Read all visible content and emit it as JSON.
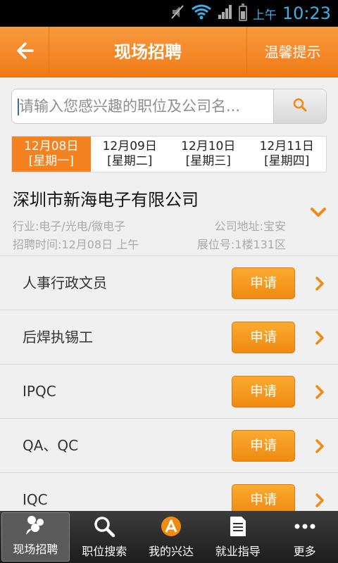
{
  "status": {
    "ampm": "上午",
    "time": "10:23"
  },
  "header": {
    "title": "现场招聘",
    "tip_label": "温馨提示"
  },
  "search": {
    "placeholder": "请输入您感兴趣的职位及公司名..."
  },
  "dates": [
    {
      "date": "12月08日",
      "weekday": "[星期一]"
    },
    {
      "date": "12月09日",
      "weekday": "[星期二]"
    },
    {
      "date": "12月10日",
      "weekday": "[星期三]"
    },
    {
      "date": "12月11日",
      "weekday": "[星期四]"
    }
  ],
  "company": {
    "name": "深圳市新海电子有限公司",
    "industry": "行业:电子/光电/微电子",
    "address": "公司地址:宝安",
    "time": "招聘时间:12月08日 上午",
    "booth": "展位号:1楼131区"
  },
  "apply_label": "申请",
  "jobs": [
    {
      "name": "人事行政文员"
    },
    {
      "name": "后焊执锡工"
    },
    {
      "name": "IPQC"
    },
    {
      "name": "QA、QC"
    },
    {
      "name": "IQC"
    }
  ],
  "tabs": [
    {
      "label": "现场招聘"
    },
    {
      "label": "职位搜索"
    },
    {
      "label": "我的兴达"
    },
    {
      "label": "就业指导"
    },
    {
      "label": "更多"
    }
  ],
  "colors": {
    "accent": "#f58220",
    "header": "#f07a16",
    "status_time": "#3ab0e8"
  }
}
